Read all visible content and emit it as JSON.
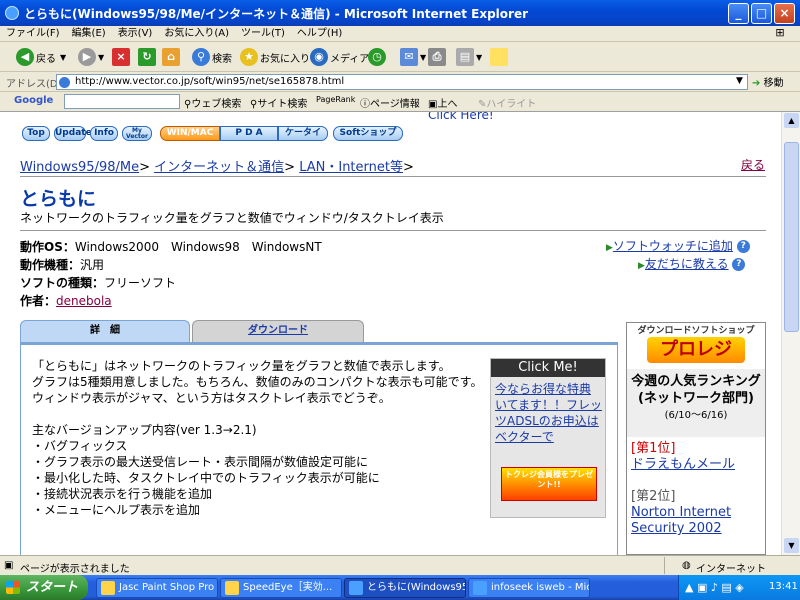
{
  "window": {
    "title": "とらもに(Windows95/98/Me/インターネット＆通信) - Microsoft Internet Explorer",
    "min": "_",
    "max": "□",
    "close": "×"
  },
  "menu": [
    "ファイル(F)",
    "編集(E)",
    "表示(V)",
    "お気に入り(A)",
    "ツール(T)",
    "ヘルプ(H)"
  ],
  "toolbar": {
    "back": "戻る",
    "search": "検索",
    "favorites": "お気に入り",
    "media": "メディア"
  },
  "address": {
    "label": "アドレス(D)",
    "url": "http://www.vector.co.jp/soft/win95/net/se165878.html",
    "go": "移動"
  },
  "google": {
    "brand": "Google",
    "web_search": "ウェブ検索",
    "site_search": "サイト検索",
    "pagerank": "PageRank",
    "page_info": "ページ情報",
    "up": "上へ",
    "highlight": "ハイライト"
  },
  "nav": {
    "top": "Top",
    "update": "Update",
    "info": "Info",
    "myvector": "My Vector",
    "winmac": "WIN/MAC",
    "pda": "P D A",
    "keitai": "ケータイ",
    "softshop": "Softショップ",
    "clickhere": "Click Here!"
  },
  "breadcrumb": {
    "c1": "Windows95/98/Me",
    "c2": "インターネット＆通信",
    "c3": "LAN・Internet等",
    "back": "戻る",
    "sep": ">"
  },
  "app": {
    "title": "とらもに",
    "desc": "ネットワークのトラフィック量をグラフと数値でウィンドウ/タスクトレイ表示",
    "os_label": "動作OS：",
    "os_value": "Windows2000　Windows98　WindowsNT",
    "model_label": "動作機種：",
    "model_value": "汎用",
    "type_label": "ソフトの種類：",
    "type_value": "フリーソフト",
    "author_label": "作者：",
    "author_value": "denebola",
    "watch": "ソフトウォッチに追加",
    "tell": "友だちに教える",
    "help": "?"
  },
  "tabs": {
    "detail": "詳　細",
    "download": "ダウンロード"
  },
  "detail": [
    "「とらもに」はネットワークのトラフィック量をグラフと数値で表示します。",
    "グラフは5種類用意しました。もちろん、数値のみのコンパクトな表示も可能です。",
    "ウィンドウ表示がジャマ、という方はタスクトレイ表示でどうぞ。",
    "",
    "主なバージョンアップ内容(ver 1.3→2.1)",
    "・バグフィックス",
    "・グラフ表示の最大送受信レート・表示間隔が数値設定可能に",
    "・最小化した時、タスクトレイ中でのトラフィック表示が可能に",
    "・接続状況表示を行う機能を追加",
    "・メニューにヘルプ表示を追加"
  ],
  "ad": {
    "header": "Click Me!",
    "body": "今ならお得な特典いてます！！フレッツADSLのお申込はベクターで",
    "banner": "トクレジ会員様をプレゼント!!"
  },
  "shop": {
    "header": "ダウンロードソフトショップ",
    "logo": "プロレジ",
    "ranking": "今週の人気ランキング",
    "category": "(ネットワーク部門)",
    "dates": "(6/10〜6/16)",
    "rank1": "[第1位]",
    "item1": "ドラえもんメール",
    "rank2": "[第2位]",
    "item2": "Norton Internet Security 2002"
  },
  "status": {
    "text": "ページが表示されました",
    "zone": "インターネット"
  },
  "taskbar": {
    "start": "スタート",
    "t1": "Jasc Paint Shop Pro ...",
    "t2": "SpeedEye［実効...",
    "t3": "とらもに(Windows95/9...",
    "t4": "infoseek isweb - Mic...",
    "clock": "13:41"
  }
}
